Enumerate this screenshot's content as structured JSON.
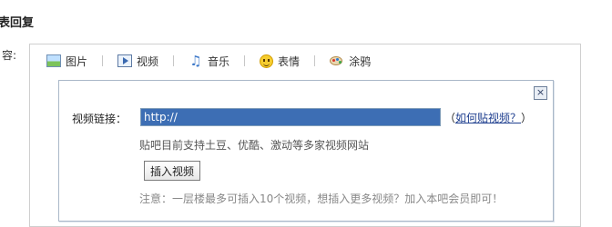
{
  "page": {
    "title": "表回复",
    "content_label": "容:"
  },
  "toolbar": {
    "items": [
      {
        "label": "图片",
        "icon": "image-icon"
      },
      {
        "label": "视频",
        "icon": "video-icon"
      },
      {
        "label": "音乐",
        "icon": "music-icon"
      },
      {
        "label": "表情",
        "icon": "smiley-icon"
      },
      {
        "label": "涂鸦",
        "icon": "paint-palette-icon"
      }
    ]
  },
  "video_panel": {
    "close_glyph": "×",
    "link_label": "视频链接：",
    "url_value": "http://",
    "help_open": "（",
    "help_link": "如何贴视频？",
    "help_close": "）",
    "supported_note": "贴吧目前支持土豆、优酷、激动等多家视频网站",
    "insert_button": "插入视频",
    "limit_note": "注意：一层楼最多可插入10个视频，想插入更多视频？加入本吧会员即可！"
  },
  "colors": {
    "link": "#1f3f8f",
    "selection": "#3d6eb4",
    "panel_border": "#a9b7c8"
  }
}
